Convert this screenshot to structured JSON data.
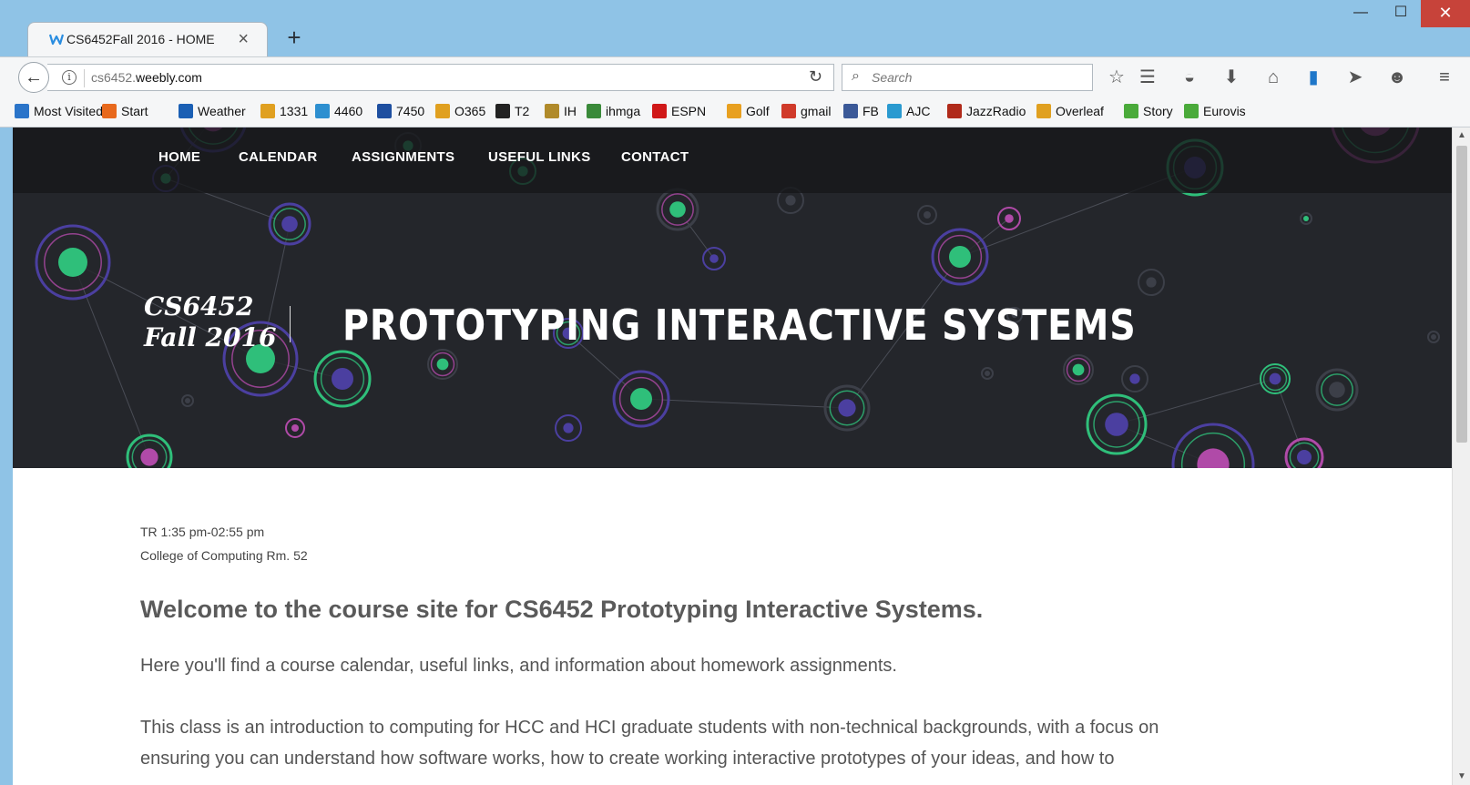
{
  "browser": {
    "tab_title": "CS6452Fall 2016 - HOME",
    "tab_close": "×",
    "new_tab": "+",
    "url_prefix": "cs6452.",
    "url_domain": "weebly.com",
    "search_placeholder": "Search",
    "window_min": "—",
    "window_max": "☐",
    "window_close": "✕",
    "bookmarks": [
      {
        "label": "Most Visited",
        "color": "#2a74c9"
      },
      {
        "label": "Start",
        "color": "#e8691c"
      },
      {
        "label": "Weather",
        "color": "#1a5fb4"
      },
      {
        "label": "1331",
        "color": "#e0a020"
      },
      {
        "label": "4460",
        "color": "#2d8fd0"
      },
      {
        "label": "7450",
        "color": "#1e4fa0"
      },
      {
        "label": "O365",
        "color": "#e0a020"
      },
      {
        "label": "T2",
        "color": "#222222"
      },
      {
        "label": "IH",
        "color": "#b08a2a"
      },
      {
        "label": "ihmga",
        "color": "#3a8a3a"
      },
      {
        "label": "ESPN",
        "color": "#d01818"
      },
      {
        "label": "Golf",
        "color": "#e8a020"
      },
      {
        "label": "gmail",
        "color": "#d03a2a"
      },
      {
        "label": "FB",
        "color": "#3b5998"
      },
      {
        "label": "AJC",
        "color": "#2a9ad0"
      },
      {
        "label": "JazzRadio",
        "color": "#b02a1a"
      },
      {
        "label": "Overleaf",
        "color": "#e0a020"
      },
      {
        "label": "Story",
        "color": "#4aaa3a"
      },
      {
        "label": "Eurovis",
        "color": "#4aaa3a"
      }
    ]
  },
  "site": {
    "nav": [
      "HOME",
      "CALENDAR",
      "ASSIGNMENTS",
      "USEFUL LINKS",
      "CONTACT"
    ],
    "logo_line1": "CS6452",
    "logo_line2": "Fall 2016",
    "hero_title": "PROTOTYPING INTERACTIVE SYSTEMS",
    "time": "TR 1:35 pm-02:55 pm",
    "location": "College of Computing   Rm. 52",
    "welcome": "Welcome to the course site for CS6452 Prototyping Interactive Systems.",
    "para1": "Here you'll find a course calendar, useful links, and information about homework assignments.",
    "para2": "This class is an introduction to computing for HCC and HCI graduate students with non-technical backgrounds, with a focus on",
    "para3": "ensuring you can understand how software works, how to create working interactive prototypes of your ideas, and how to"
  },
  "colors": {
    "hero_bg": "#24262b",
    "green": "#2fbf7a",
    "purple": "#4b3fa0",
    "magenta": "#b04aa8"
  }
}
